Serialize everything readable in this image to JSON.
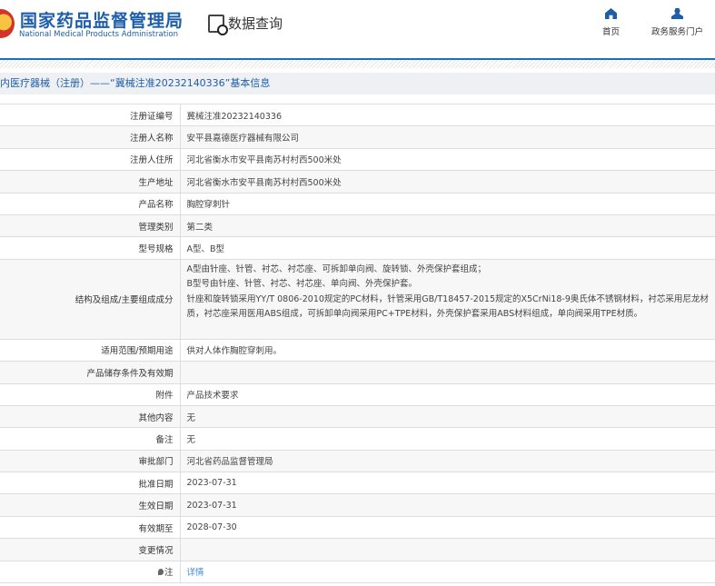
{
  "header": {
    "logo_cn": "国家药品监督管理局",
    "logo_en": "National Medical Products Administration",
    "section": "数据查询",
    "nav": [
      {
        "label": "首页",
        "icon": "home-icon"
      },
      {
        "label": "政务服务门户",
        "icon": "user-icon"
      }
    ]
  },
  "title": "内医疗器械（注册）——“冀械注准20232140336”基本信息",
  "rows": [
    {
      "label": "注册证编号",
      "value": "冀械注准20232140336"
    },
    {
      "label": "注册人名称",
      "value": "安平县嘉德医疗器械有限公司"
    },
    {
      "label": "注册人住所",
      "value": "河北省衡水市安平县南苏村村西500米处"
    },
    {
      "label": "生产地址",
      "value": "河北省衡水市安平县南苏村村西500米处"
    },
    {
      "label": "产品名称",
      "value": "胸腔穿刺针"
    },
    {
      "label": "管理类别",
      "value": "第二类"
    },
    {
      "label": "型号规格",
      "value": "A型、B型"
    },
    {
      "label": "结构及组成/主要组成成分",
      "lines": [
        "A型由针座、针管、衬芯、衬芯座、可拆卸单向阀、旋转锁、外壳保护套组成；",
        "B型号由针座、针管、衬芯、衬芯座、单向阀、外壳保护套。",
        "针座和旋转锁采用YY/T 0806-2010规定的PC材料，针管采用GB/T18457-2015规定的X5CrNi18-9奥氏体不锈钢材料，衬芯采用尼龙材质，衬芯座采用医用ABS组成，可拆卸单向阀采用PC+TPE材料，外壳保护套采用ABS材料组成，单向阀采用TPE材质。"
      ]
    },
    {
      "label": "适用范围/预期用途",
      "value": "供对人体作胸腔穿刺用。"
    },
    {
      "label": "产品储存条件及有效期",
      "value": ""
    },
    {
      "label": "附件",
      "value": "产品技术要求"
    },
    {
      "label": "其他内容",
      "value": "无"
    },
    {
      "label": "备注",
      "value": "无"
    },
    {
      "label": "审批部门",
      "value": "河北省药品监督管理局"
    },
    {
      "label": "批准日期",
      "value": "2023-07-31"
    },
    {
      "label": "生效日期",
      "value": "2023-07-31"
    },
    {
      "label": "有效期至",
      "value": "2028-07-30"
    },
    {
      "label": "变更情况",
      "value": ""
    }
  ],
  "note": {
    "label": "注",
    "link": "详情"
  }
}
